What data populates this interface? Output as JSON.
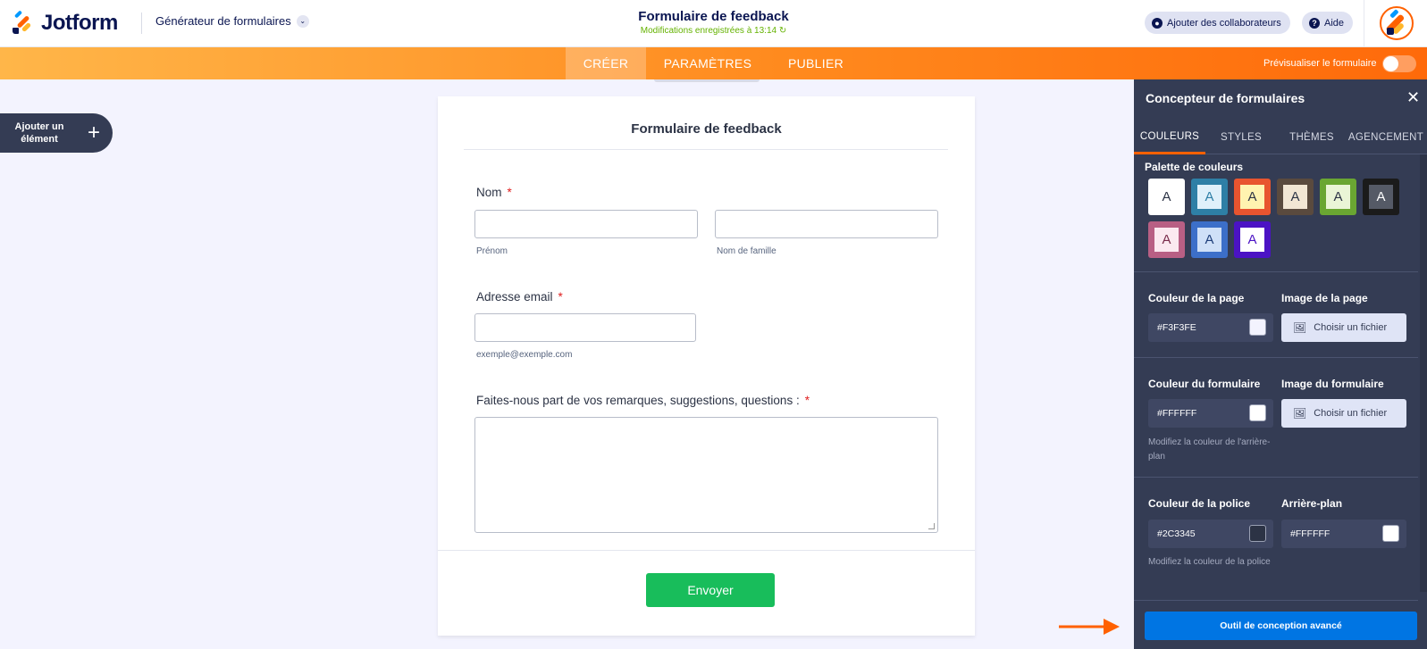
{
  "header": {
    "brand": "Jotform",
    "builder_menu": "Générateur de formulaires",
    "form_title": "Formulaire de feedback",
    "save_status": "Modifications enregistrées à 13:14 ↻",
    "collaborators_label": "Ajouter des collaborateurs",
    "help_label": "Aide"
  },
  "nav": {
    "tabs": [
      {
        "label": "CRÉER",
        "active": true
      },
      {
        "label": "PARAMÈTRES",
        "active": false
      },
      {
        "label": "PUBLIER",
        "active": false
      }
    ],
    "preview_label": "Prévisualiser le formulaire",
    "preview_enabled": false
  },
  "sidebar": {
    "add_element_label": "Ajouter un élément",
    "add_icon": "plus-icon"
  },
  "form": {
    "title": "Formulaire de feedback",
    "fields": {
      "name_label": "Nom",
      "required_mark": "*",
      "first_name_sublabel": "Prénom",
      "last_name_sublabel": "Nom de famille",
      "email_label": "Adresse email",
      "email_sublabel": "exemple@exemple.com",
      "comments_label": "Faites-nous part de vos remarques, suggestions, questions :"
    },
    "submit_label": "Envoyer"
  },
  "designer": {
    "title": "Concepteur de formulaires",
    "tabs": [
      {
        "label": "COULEURS",
        "active": true
      },
      {
        "label": "STYLES",
        "active": false
      },
      {
        "label": "THÈMES",
        "active": false
      },
      {
        "label": "AGENCEMENT",
        "active": false
      }
    ],
    "palette_title": "Palette de couleurs",
    "palette": [
      {
        "letter": "A",
        "outer": "#ffffff",
        "inner": "#ffffff",
        "text": "#2c3345"
      },
      {
        "letter": "A",
        "outer": "#2e7fa6",
        "inner": "#dff0fa",
        "text": "#2e7fa6"
      },
      {
        "letter": "A",
        "outer": "#e8542f",
        "inner": "#fff3b0",
        "text": "#2c3345"
      },
      {
        "letter": "A",
        "outer": "#5a4a3e",
        "inner": "#f2e6d4",
        "text": "#2c3345"
      },
      {
        "letter": "A",
        "outer": "#6aa632",
        "inner": "#eaf5d6",
        "text": "#2c3345"
      },
      {
        "letter": "A",
        "outer": "#1b1b1b",
        "inner": "#555a66",
        "text": "#ffffff"
      },
      {
        "letter": "A",
        "outer": "#b85f84",
        "inner": "#fbe9f0",
        "text": "#7a2d4c"
      },
      {
        "letter": "A",
        "outer": "#3c6fc9",
        "inner": "#cfe0f7",
        "text": "#1f3f7a"
      },
      {
        "letter": "A",
        "outer": "#4b13c4",
        "inner": "#ffffff",
        "text": "#4b13c4"
      }
    ],
    "page_color_title": "Couleur de la page",
    "page_color_value": "#F3F3FE",
    "page_image_title": "Image de la page",
    "choose_file_label": "Choisir un fichier",
    "form_color_title": "Couleur du formulaire",
    "form_color_value": "#FFFFFF",
    "form_color_hint": "Modifiez la couleur de l'arrière-plan",
    "form_image_title": "Image du formulaire",
    "font_color_title": "Couleur de la police",
    "font_color_value": "#2C3345",
    "font_color_hint": "Modifiez la couleur de la police",
    "background_title": "Arrière-plan",
    "background_value": "#FFFFFF",
    "advanced_label": "Outil de conception avancé"
  },
  "colors": {
    "brand_orange": "#ff6100",
    "navy": "#0a1551",
    "panel_bg": "#343c54",
    "submit_green": "#18bd5b",
    "advanced_blue": "#0075e3"
  }
}
